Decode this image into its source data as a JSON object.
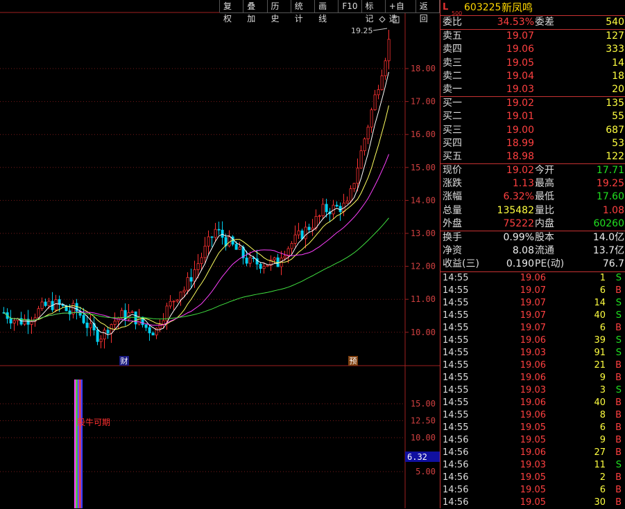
{
  "toolbar": {
    "items": [
      "复权",
      "叠加",
      "历史",
      "统计",
      "画线",
      "F10",
      "标记",
      "+自选",
      "返回"
    ]
  },
  "chart": {
    "price_axis": [
      "18.00",
      "17.00",
      "16.00",
      "15.00",
      "14.00",
      "13.00",
      "12.00",
      "11.00",
      "10.00"
    ],
    "high_label": "19.25",
    "marker_cai": "财",
    "marker_yu": "预",
    "ind_axis": [
      "15.00",
      "12.50",
      "10.00",
      "5.00"
    ],
    "ind_value": "6.32",
    "ind_text": "股牛可期",
    "colors": {
      "up": "#ff3232",
      "down": "#00d0f0",
      "ma5": "#ffffff",
      "ma10": "#ffff60",
      "ma20": "#ff40ff",
      "ma60": "#40e040"
    }
  },
  "stock": {
    "market": "L",
    "mkt_tag": "500",
    "code": "603225",
    "name": "新凤鸣"
  },
  "ratio": {
    "label1": "委比",
    "v1": "34.53%",
    "label2": "委差",
    "v2": "540"
  },
  "asks": [
    {
      "label": "卖五",
      "price": "19.07",
      "vol": "127"
    },
    {
      "label": "卖四",
      "price": "19.06",
      "vol": "333"
    },
    {
      "label": "卖三",
      "price": "19.05",
      "vol": "14"
    },
    {
      "label": "卖二",
      "price": "19.04",
      "vol": "18"
    },
    {
      "label": "卖一",
      "price": "19.03",
      "vol": "20"
    }
  ],
  "bids": [
    {
      "label": "买一",
      "price": "19.02",
      "vol": "135"
    },
    {
      "label": "买二",
      "price": "19.01",
      "vol": "55"
    },
    {
      "label": "买三",
      "price": "19.00",
      "vol": "687"
    },
    {
      "label": "买四",
      "price": "18.99",
      "vol": "53"
    },
    {
      "label": "买五",
      "price": "18.98",
      "vol": "122"
    }
  ],
  "quote": [
    {
      "l1": "现价",
      "v1": "19.02",
      "c1": "red",
      "l2": "今开",
      "v2": "17.71",
      "c2": "green"
    },
    {
      "l1": "涨跌",
      "v1": "1.13",
      "c1": "red",
      "l2": "最高",
      "v2": "19.25",
      "c2": "red"
    },
    {
      "l1": "涨幅",
      "v1": "6.32%",
      "c1": "red",
      "l2": "最低",
      "v2": "17.60",
      "c2": "green"
    },
    {
      "l1": "总量",
      "v1": "135482",
      "c1": "yel",
      "l2": "量比",
      "v2": "1.08",
      "c2": "red"
    },
    {
      "l1": "外盘",
      "v1": "75222",
      "c1": "red",
      "l2": "内盘",
      "v2": "60260",
      "c2": "green"
    }
  ],
  "fund": [
    {
      "l1": "换手",
      "v1": "0.99%",
      "l2": "股本",
      "v2": "14.0亿"
    },
    {
      "l1": "净资",
      "v1": "8.08",
      "l2": "流通",
      "v2": "13.7亿"
    },
    {
      "l1": "收益(三)",
      "v1": "0.190",
      "l2": "PE(动)",
      "v2": "76.7"
    }
  ],
  "ticks": [
    {
      "t": "14:55",
      "p": "19.06",
      "v": "1",
      "s": "S"
    },
    {
      "t": "14:55",
      "p": "19.07",
      "v": "6",
      "s": "B"
    },
    {
      "t": "14:55",
      "p": "19.07",
      "v": "14",
      "s": "S"
    },
    {
      "t": "14:55",
      "p": "19.07",
      "v": "40",
      "s": "S"
    },
    {
      "t": "14:55",
      "p": "19.07",
      "v": "6",
      "s": "B"
    },
    {
      "t": "14:55",
      "p": "19.06",
      "v": "39",
      "s": "S"
    },
    {
      "t": "14:55",
      "p": "19.03",
      "v": "91",
      "s": "S"
    },
    {
      "t": "14:55",
      "p": "19.06",
      "v": "21",
      "s": "B"
    },
    {
      "t": "14:55",
      "p": "19.06",
      "v": "9",
      "s": "B"
    },
    {
      "t": "14:55",
      "p": "19.03",
      "v": "3",
      "s": "S"
    },
    {
      "t": "14:55",
      "p": "19.06",
      "v": "40",
      "s": "B"
    },
    {
      "t": "14:55",
      "p": "19.06",
      "v": "8",
      "s": "B"
    },
    {
      "t": "14:55",
      "p": "19.05",
      "v": "6",
      "s": "B"
    },
    {
      "t": "14:56",
      "p": "19.05",
      "v": "9",
      "s": "B"
    },
    {
      "t": "14:56",
      "p": "19.06",
      "v": "27",
      "s": "B"
    },
    {
      "t": "14:56",
      "p": "19.03",
      "v": "11",
      "s": "S"
    },
    {
      "t": "14:56",
      "p": "19.05",
      "v": "2",
      "s": "B"
    },
    {
      "t": "14:56",
      "p": "19.05",
      "v": "6",
      "s": "B"
    },
    {
      "t": "14:56",
      "p": "19.05",
      "v": "30",
      "s": "B"
    }
  ]
}
